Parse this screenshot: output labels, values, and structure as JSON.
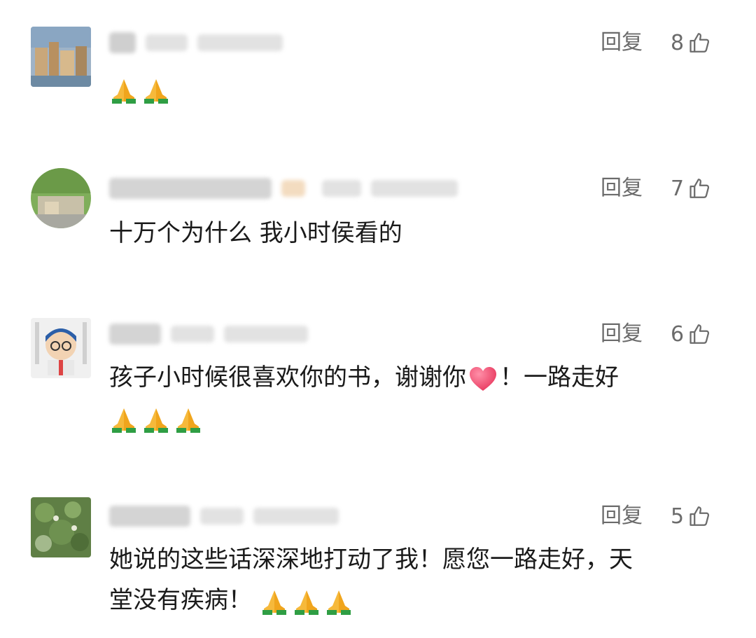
{
  "comments": [
    {
      "reply_label": "回复",
      "likes": "8",
      "avatar": "photo-avatar-city",
      "text": "",
      "emoji_count": 2
    },
    {
      "reply_label": "回复",
      "likes": "7",
      "avatar": "photo-avatar-nature",
      "text": "十万个为什么 我小时侯看的",
      "emoji_count": 0
    },
    {
      "reply_label": "回复",
      "likes": "6",
      "avatar": "cartoon-avatar",
      "text_before_heart": "孩子小时候很喜欢你的书，谢谢你",
      "text_after_heart": "！一路走好",
      "emoji_count": 3
    },
    {
      "reply_label": "回复",
      "likes": "5",
      "avatar": "photo-avatar-plant",
      "text_line1": "她说的这些话深深地打动了我！愿您一路走好，天",
      "text_line2": "堂没有疾病！",
      "emoji_count": 3
    }
  ],
  "icons": {
    "like": "thumbs-up-icon",
    "emoji": "folded-hands-emoji",
    "heart": "red-heart-emoji"
  },
  "colors": {
    "meta_gray": "#6b6b6b",
    "text": "#1a1a1a",
    "blur": "#d9d9d9"
  }
}
